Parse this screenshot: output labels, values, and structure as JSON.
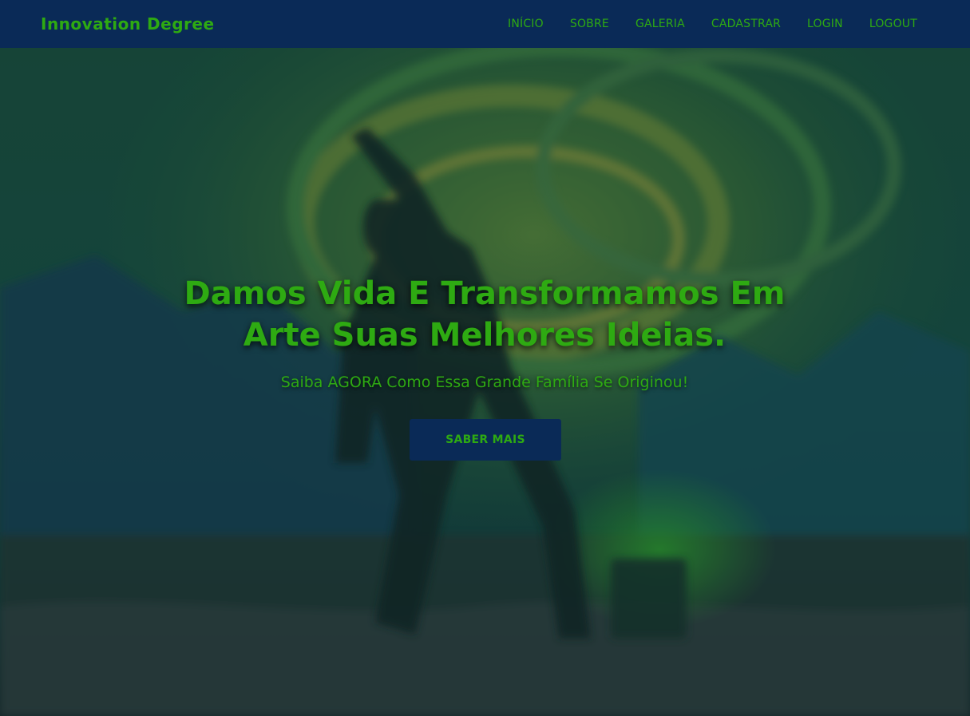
{
  "header": {
    "brand": "Innovation Degree",
    "nav": [
      {
        "label": "INÍCIO"
      },
      {
        "label": "SOBRE"
      },
      {
        "label": "GALERIA"
      },
      {
        "label": "CADASTRAR"
      },
      {
        "label": "LOGIN"
      },
      {
        "label": "LOGOUT"
      }
    ]
  },
  "hero": {
    "title": "Damos Vida E Transformamos Em Arte Suas Melhores Ideias.",
    "subtitle": "Saiba AGORA Como Essa Grande Família Se Originou!",
    "button_label": "SABER MAIS"
  },
  "colors": {
    "navbar": "#0a2a57",
    "accent": "#2eaa12",
    "button_bg": "#0a2a57"
  }
}
